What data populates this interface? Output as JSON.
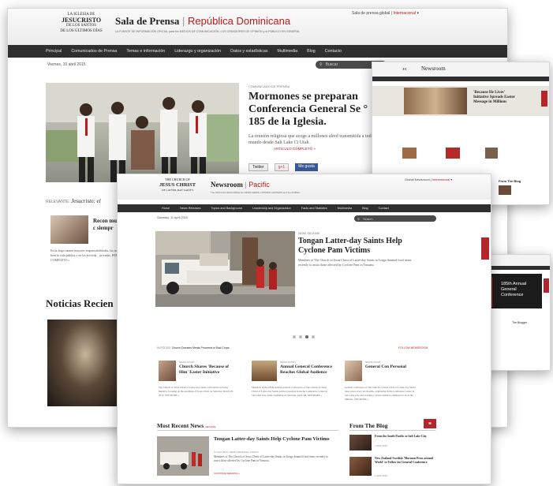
{
  "spanish": {
    "logo_lines": [
      "LA IGLESIA DE",
      "JESUCRISTO",
      "DE LOS SANTOS",
      "DE LOS ÚLTIMOS DÍAS"
    ],
    "site_title": "Sala de Prensa",
    "region": "República Dominicana",
    "tagline": "LA FUENTE DE INFORMACIÓN OFICIAL para los MEDIOS DE COMUNICACIÓN, LOS CREADORES DE OPINIÓN y el PÚBLICO EN GENERAL",
    "top_link": "Sala de prensa global",
    "top_link2": "Internacional",
    "nav": [
      "Principal",
      "Comunicados de Prensa",
      "Temas e información",
      "Liderazgo y organización",
      "Datos y estadísticas",
      "Multimedia",
      "Blog",
      "Contacto"
    ],
    "date": "Viernes, 10 abril 2015",
    "search_placeholder": "Buscar",
    "kicker": "COMUNICADO DE PRENSA",
    "headline": "Mormones se preparan Conferencia General Se ° 185 de la Iglesia.",
    "lead": "La reunión religiosa que acoge a millones alred transmitida a todo el mundo desde Salt Lake Ci Utah.",
    "more": "ARTÍCULO COMPLETO »",
    "share": [
      "Twitter",
      "g+1",
      "Me gusta"
    ],
    "relevant_label": "RELEVANTE:",
    "relevant_text": "Jesucristo: el",
    "side_title": "Recon mujer c siempr",
    "side_body": "En la dispo asume mayores responsabilidades, las mujeres bien la vida pública y en las activida... privadas. RELATO COMPLETO »",
    "section": "Noticias Recien"
  },
  "pacific": {
    "logo_lines": [
      "THE CHURCH OF",
      "JESUS CHRIST",
      "OF LATTER-DAY SAINTS"
    ],
    "site_title": "Newsroom",
    "region": "Pacific",
    "tagline": "The OFFICIAL RESOURCE for NEWS MEDIA, OPINION LEADERS and the PUBLIC",
    "top_link": "Global Newsroom",
    "top_link2": "International",
    "nav": [
      "Home",
      "News Releases",
      "Topics and Background",
      "Leadership and Organization",
      "Facts and Statistics",
      "Multimedia",
      "Blog",
      "Contact"
    ],
    "date": "Saturday, 11 April 2015",
    "search_placeholder": "Search",
    "kicker": "NEWS RELEASE",
    "headline": "Tongan Latter-day Saints Help Cyclone Pam Victims",
    "lead": "Members of The Church of Jesus Christ of Latter-day Saints in Tonga donated food items recently to assist those affected by Cyclone Pam in Vanuatu.",
    "more": "CONTINUE READING »",
    "related_label": "IN FOCUS:",
    "related_text": "Church Donates Meats Proceeds to Bad Crops",
    "follow": "FOLLOW NEWSROOM",
    "cards": [
      {
        "kicker": "NEWS STORY",
        "title": "Church Shares 'Because of Him' Easter Initiative",
        "body": "The Church of Jesus Christ of Latter-day Saints will launch an Easter initiative focusing on the teachings of Jesus Christ on Saturday, March 28, 2015. SEE MORE »"
      },
      {
        "kicker": "NEWS STORY",
        "title": "Annual General Conference Reaches Global Audience",
        "body": "Members of the 185th Annual General Conference of The Church of Jesus Christ of Latter-day Saints will be broadcast from the Conference Center in Salt Lake City, Utah, beginning on Saturday, April 4th. SEE MORE »"
      },
      {
        "kicker": "NEWS STORY",
        "title": "General Con Personal",
        "body": "General conference of The Church of Jesus Christ of Latter-day Saints takes place every six months, originating in the Conference Center in Salt Lake City and reaching a global audience estimated to be in the millions. SEE MORE »"
      }
    ],
    "recent_title": "Most Recent News",
    "recent_more": "ARCHIVE",
    "recent_headline": "Tongan Latter-day Saints Help Cyclone Pam Victims",
    "recent_date": "10 April 2015 | NEWS RELEASE | TONGA",
    "recent_body": "Members of The Church of Jesus Christ of Latter-day Saints in Tonga donated food items recently to assist those affected by Cyclone Pam in Vanuatu.",
    "recent_more_link": "CONTINUE READING »",
    "blog_title": "From The Blog",
    "blog_items": [
      {
        "title": "From the South Pacific to Salt Lake City",
        "date": "7 APR 2015"
      },
      {
        "title": "New Zealand Swedish 'Mormon Press around World' to Follow for General Conference",
        "date": "1 APR 2015"
      }
    ]
  },
  "english": {
    "title": "Newsroom",
    "story_title": "'Because He Lives' Initiative Spreads Easter Message in Millions",
    "blog": "From The Blog"
  },
  "small": {
    "title": "Newsroom",
    "banner_line1": "185th Annual",
    "banner_line2": "General",
    "banner_line3": "Conference",
    "side_label": "The Blogger"
  }
}
